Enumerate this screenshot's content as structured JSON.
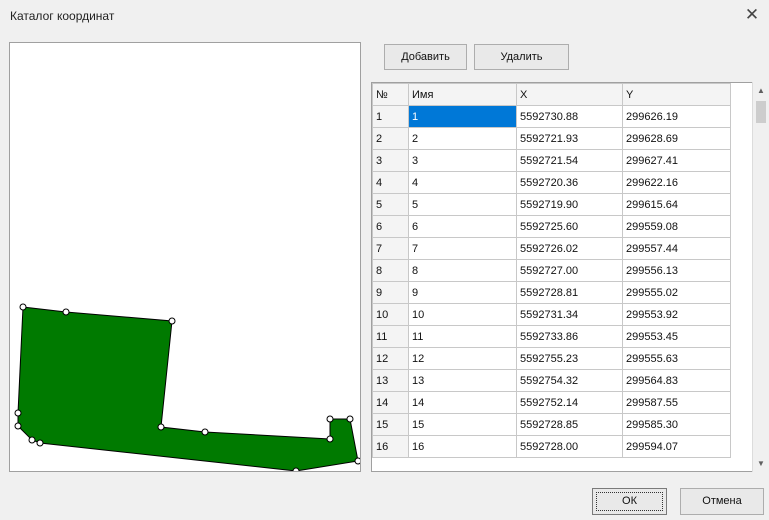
{
  "window": {
    "title": "Каталог координат",
    "close_glyph": "✕"
  },
  "toolbar": {
    "add_label": "Добавить",
    "delete_label": "Удалить"
  },
  "footer": {
    "ok_label": "ОК",
    "cancel_label": "Отмена"
  },
  "colors": {
    "polygon_fill": "#007a00",
    "selection": "#0078d7"
  },
  "icons": {
    "close": "close-icon",
    "scroll_up": "chevron-up-icon",
    "scroll_down": "chevron-down-icon"
  },
  "grid": {
    "headers": [
      "№",
      "Имя",
      "X",
      "Y"
    ],
    "selected_row": 1,
    "rows": [
      [
        "1",
        "1",
        "5592730.88",
        "299626.19"
      ],
      [
        "2",
        "2",
        "5592721.93",
        "299628.69"
      ],
      [
        "3",
        "3",
        "5592721.54",
        "299627.41"
      ],
      [
        "4",
        "4",
        "5592720.36",
        "299622.16"
      ],
      [
        "5",
        "5",
        "5592719.90",
        "299615.64"
      ],
      [
        "6",
        "6",
        "5592725.60",
        "299559.08"
      ],
      [
        "7",
        "7",
        "5592726.02",
        "299557.44"
      ],
      [
        "8",
        "8",
        "5592727.00",
        "299556.13"
      ],
      [
        "9",
        "9",
        "5592728.81",
        "299555.02"
      ],
      [
        "10",
        "10",
        "5592731.34",
        "299553.92"
      ],
      [
        "11",
        "11",
        "5592733.86",
        "299553.45"
      ],
      [
        "12",
        "12",
        "5592755.23",
        "299555.63"
      ],
      [
        "13",
        "13",
        "5592754.32",
        "299564.83"
      ],
      [
        "14",
        "14",
        "5592752.14",
        "299587.55"
      ],
      [
        "15",
        "15",
        "5592728.85",
        "299585.30"
      ],
      [
        "16",
        "16",
        "5592728.00",
        "299594.07"
      ]
    ]
  }
}
